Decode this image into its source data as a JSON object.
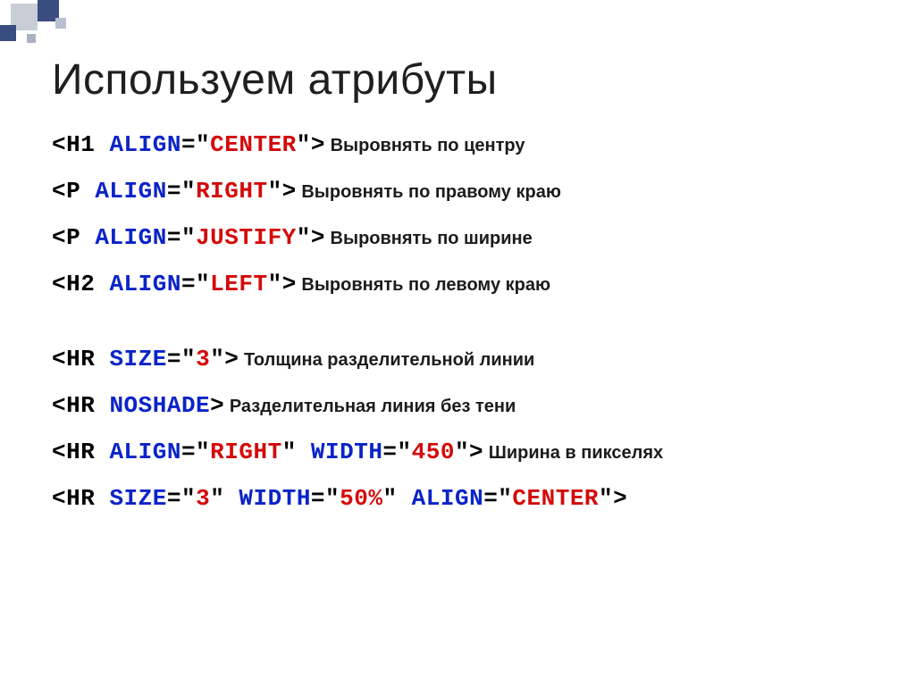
{
  "title": "Используем атрибуты",
  "lines": [
    {
      "tokens": [
        {
          "t": "<",
          "c": "black"
        },
        {
          "t": "H1",
          "c": "black"
        },
        {
          "t": " ",
          "c": "black"
        },
        {
          "t": "ALIGN",
          "c": "blue"
        },
        {
          "t": "=\"",
          "c": "black"
        },
        {
          "t": "CENTER",
          "c": "red"
        },
        {
          "t": "\">",
          "c": "black"
        }
      ],
      "desc": " Выровнять по центру",
      "gap": false
    },
    {
      "tokens": [
        {
          "t": "<",
          "c": "black"
        },
        {
          "t": "P",
          "c": "black"
        },
        {
          "t": " ",
          "c": "black"
        },
        {
          "t": "ALIGN",
          "c": "blue"
        },
        {
          "t": "=\"",
          "c": "black"
        },
        {
          "t": "RIGHT",
          "c": "red"
        },
        {
          "t": "\">",
          "c": "black"
        }
      ],
      "desc": " Выровнять по правому краю",
      "gap": false
    },
    {
      "tokens": [
        {
          "t": "<",
          "c": "black"
        },
        {
          "t": "P",
          "c": "black"
        },
        {
          "t": " ",
          "c": "black"
        },
        {
          "t": "ALIGN",
          "c": "blue"
        },
        {
          "t": "=\"",
          "c": "black"
        },
        {
          "t": "JUSTIFY",
          "c": "red"
        },
        {
          "t": "\">",
          "c": "black"
        }
      ],
      "desc": " Выровнять по ширине",
      "gap": false
    },
    {
      "tokens": [
        {
          "t": "<",
          "c": "black"
        },
        {
          "t": "H2",
          "c": "black"
        },
        {
          "t": " ",
          "c": "black"
        },
        {
          "t": "ALIGN",
          "c": "blue"
        },
        {
          "t": "=\"",
          "c": "black"
        },
        {
          "t": "LEFT",
          "c": "red"
        },
        {
          "t": "\">",
          "c": "black"
        }
      ],
      "desc": " Выровнять по левому краю",
      "gap": false
    },
    {
      "tokens": [
        {
          "t": "<",
          "c": "black"
        },
        {
          "t": "HR",
          "c": "black"
        },
        {
          "t": " ",
          "c": "black"
        },
        {
          "t": "SIZE",
          "c": "blue"
        },
        {
          "t": "=\"",
          "c": "black"
        },
        {
          "t": "3",
          "c": "red"
        },
        {
          "t": "\">",
          "c": "black"
        }
      ],
      "desc": " Толщина разделительной линии",
      "gap": true
    },
    {
      "tokens": [
        {
          "t": "<",
          "c": "black"
        },
        {
          "t": "HR",
          "c": "black"
        },
        {
          "t": " ",
          "c": "black"
        },
        {
          "t": "NOSHADE",
          "c": "blue"
        },
        {
          "t": ">",
          "c": "black"
        }
      ],
      "desc": " Разделительная линия без тени",
      "gap": false
    },
    {
      "tokens": [
        {
          "t": "<",
          "c": "black"
        },
        {
          "t": "HR",
          "c": "black"
        },
        {
          "t": " ",
          "c": "black"
        },
        {
          "t": "ALIGN",
          "c": "blue"
        },
        {
          "t": "=\"",
          "c": "black"
        },
        {
          "t": "RIGHT",
          "c": "red"
        },
        {
          "t": "\"",
          "c": "black"
        },
        {
          "t": " ",
          "c": "black"
        },
        {
          "t": "WIDTH",
          "c": "blue"
        },
        {
          "t": "=\"",
          "c": "black"
        },
        {
          "t": "450",
          "c": "red"
        },
        {
          "t": "\">",
          "c": "black"
        }
      ],
      "desc": " Ширина в пикселях",
      "gap": false
    },
    {
      "tokens": [
        {
          "t": "<",
          "c": "black"
        },
        {
          "t": "HR",
          "c": "black"
        },
        {
          "t": " ",
          "c": "black"
        },
        {
          "t": "SIZE",
          "c": "blue"
        },
        {
          "t": "=\"",
          "c": "black"
        },
        {
          "t": "3",
          "c": "red"
        },
        {
          "t": "\"",
          "c": "black"
        },
        {
          "t": " ",
          "c": "black"
        },
        {
          "t": "WIDTH",
          "c": "blue"
        },
        {
          "t": "=\"",
          "c": "black"
        },
        {
          "t": "50%",
          "c": "red"
        },
        {
          "t": "\"",
          "c": "black"
        },
        {
          "t": " ",
          "c": "black"
        },
        {
          "t": "ALIGN",
          "c": "blue"
        },
        {
          "t": "=\"",
          "c": "black"
        },
        {
          "t": "CENTER",
          "c": "red"
        },
        {
          "t": "\">",
          "c": "black"
        }
      ],
      "desc": "",
      "gap": false
    }
  ]
}
